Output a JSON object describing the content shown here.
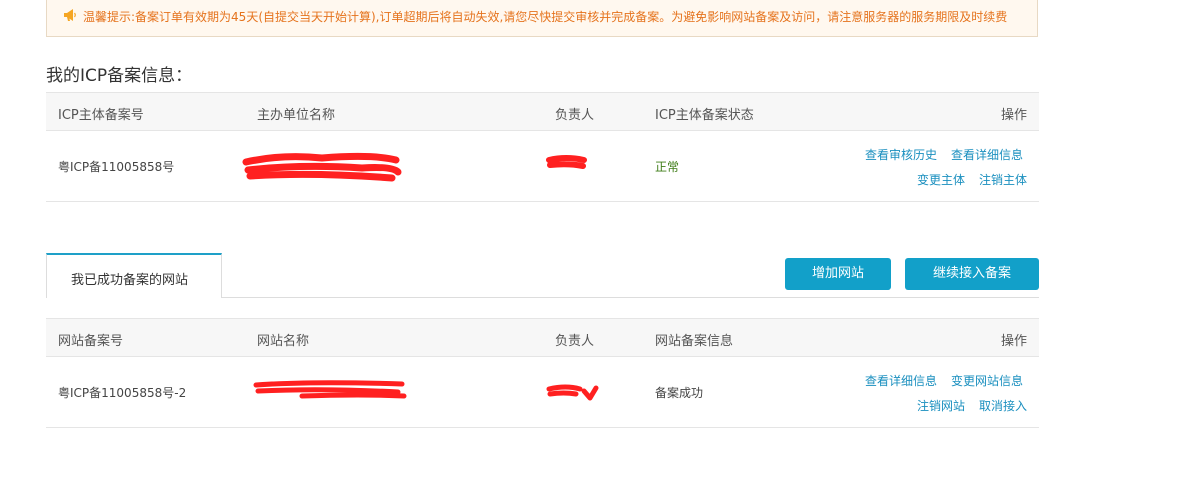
{
  "notice": {
    "icon": "megaphone-icon",
    "text": "温馨提示:备案订单有效期为45天(自提交当天开始计算),订单超期后将自动失效,请您尽快提交审核并完成备案。为避免影响网站备案及访问，请注意服务器的服务期限及时续费"
  },
  "icp_section": {
    "title": "我的ICP备案信息：",
    "headers": [
      "ICP主体备案号",
      "主办单位名称",
      "负责人",
      "ICP主体备案状态",
      "操作"
    ],
    "row": {
      "record_no": "粤ICP备11005858号",
      "status": "正常",
      "actions": [
        "查看审核历史",
        "查看详细信息",
        "变更主体",
        "注销主体"
      ]
    }
  },
  "site_section": {
    "tab_label": "我已成功备案的网站",
    "add_button": "增加网站",
    "continue_button": "继续接入备案",
    "headers": [
      "网站备案号",
      "网站名称",
      "负责人",
      "网站备案信息",
      "操作"
    ],
    "row": {
      "record_no": "粤ICP备11005858号-2",
      "info": "备案成功",
      "actions": [
        "查看详细信息",
        "变更网站信息",
        "注销网站",
        "取消接入"
      ]
    }
  },
  "colors": {
    "notice_text": "#e5731d",
    "link": "#1a8fbf",
    "button": "#12a0c9",
    "status_ok": "#3f7d18",
    "redaction": "#ff2020"
  }
}
